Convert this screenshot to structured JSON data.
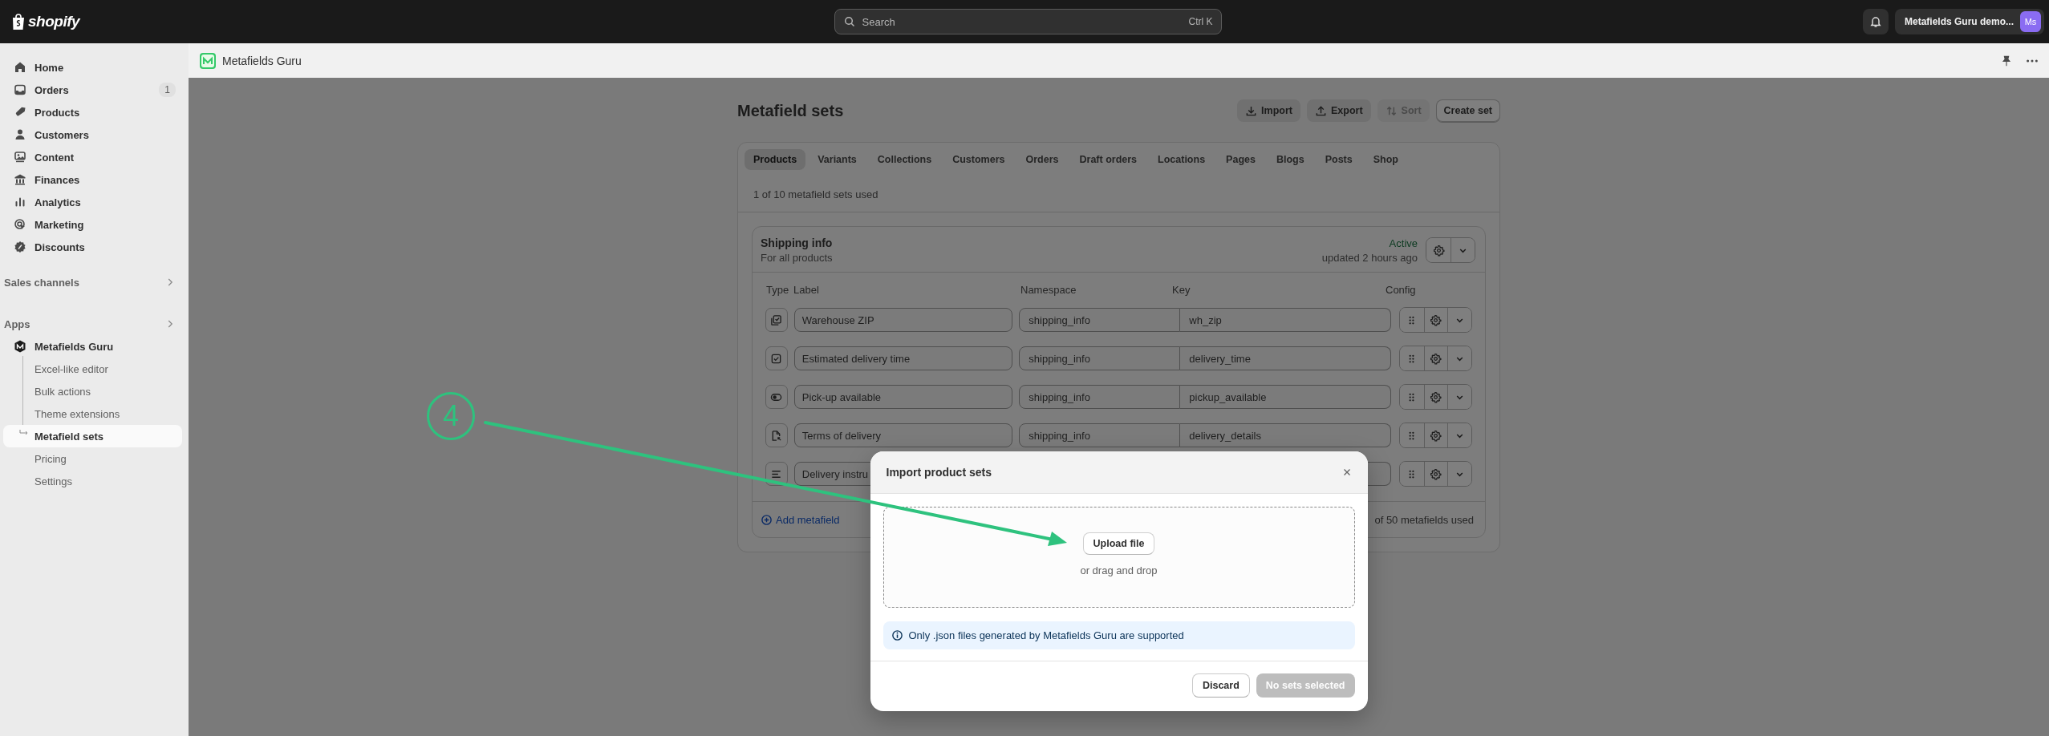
{
  "top_bar": {
    "logo": "shopify",
    "search": {
      "placeholder": "Search",
      "shortcut": "Ctrl K"
    },
    "store_name": "Metafields Guru demo...",
    "avatar": "Ms"
  },
  "sidebar": {
    "items": [
      {
        "label": "Home",
        "selected": false
      },
      {
        "label": "Orders",
        "badge": "1",
        "selected": false
      },
      {
        "label": "Products",
        "selected": false
      },
      {
        "label": "Customers",
        "selected": false
      },
      {
        "label": "Content",
        "selected": false
      },
      {
        "label": "Finances",
        "selected": false
      },
      {
        "label": "Analytics",
        "selected": false
      },
      {
        "label": "Marketing",
        "selected": false
      },
      {
        "label": "Discounts",
        "selected": false
      }
    ],
    "sections": [
      {
        "label": "Sales channels"
      },
      {
        "label": "Apps"
      }
    ],
    "app": {
      "label": "Metafields Guru",
      "items": [
        {
          "label": "Excel-like editor",
          "selected": false
        },
        {
          "label": "Bulk actions",
          "selected": false
        },
        {
          "label": "Theme extensions",
          "selected": false
        },
        {
          "label": "Metafield sets",
          "selected": true
        },
        {
          "label": "Pricing",
          "selected": false
        },
        {
          "label": "Settings",
          "selected": false
        }
      ]
    }
  },
  "app_header": {
    "title": "Metafields Guru"
  },
  "page": {
    "title": "Metafield sets",
    "actions": [
      {
        "label": "Import",
        "disabled": false
      },
      {
        "label": "Export",
        "disabled": false
      },
      {
        "label": "Sort",
        "disabled": true
      },
      {
        "label": "Create set",
        "disabled": false
      }
    ],
    "tabs": [
      {
        "label": "Products",
        "selected": true
      },
      {
        "label": "Variants",
        "selected": false
      },
      {
        "label": "Collections",
        "selected": false
      },
      {
        "label": "Customers",
        "selected": false
      },
      {
        "label": "Orders",
        "selected": false
      },
      {
        "label": "Draft orders",
        "selected": false
      },
      {
        "label": "Locations",
        "selected": false
      },
      {
        "label": "Pages",
        "selected": false
      },
      {
        "label": "Blogs",
        "selected": false
      },
      {
        "label": "Posts",
        "selected": false
      },
      {
        "label": "Shop",
        "selected": false
      }
    ],
    "usage": "1 of 10 metafield sets used",
    "set": {
      "name": "Shipping info",
      "subtitle": "For all products",
      "status": "Active",
      "updated": "updated 2 hours ago",
      "columns": [
        "Type",
        "Label",
        "Namespace",
        "Key",
        "Config"
      ],
      "rows": [
        {
          "kind": "checklist",
          "label": "Warehouse ZIP",
          "namespace": "shipping_info",
          "key": "wh_zip"
        },
        {
          "kind": "checkbox",
          "label": "Estimated delivery time",
          "namespace": "shipping_info",
          "key": "delivery_time"
        },
        {
          "kind": "toggle",
          "label": "Pick-up available",
          "namespace": "shipping_info",
          "key": "pickup_available"
        },
        {
          "kind": "file",
          "label": "Terms of delivery",
          "namespace": "shipping_info",
          "key": "delivery_details"
        },
        {
          "kind": "text",
          "label": "Delivery instru"
        }
      ],
      "add_link": "Add metafield",
      "field_usage": "of 50 metafields used"
    }
  },
  "dialog": {
    "title": "Import product sets",
    "upload_button": "Upload file",
    "drop_hint": "or drag and drop",
    "info": "Only .json files generated by Metafields Guru are supported",
    "buttons": [
      {
        "label": "Discard",
        "disabled": false
      },
      {
        "label": "No sets selected",
        "disabled": true
      }
    ]
  },
  "annotation": {
    "number": "4"
  }
}
